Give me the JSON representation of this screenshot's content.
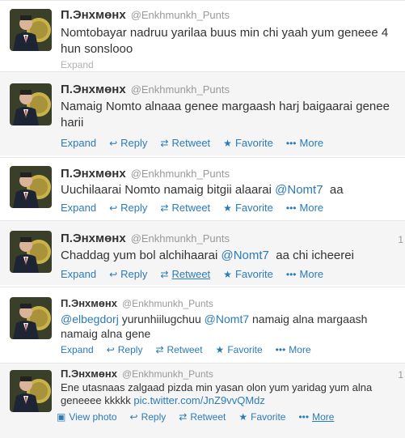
{
  "tweets": [
    {
      "name": "П.Энхмөнх",
      "handle": "@Enkhmunkh_Punts",
      "text": "Nomtobayar nadruu yarilaa buus min chi yaah yum geneee 4 hun sonslooo",
      "partial_action": "Expand"
    },
    {
      "name": "П.Энхмөнх",
      "handle": "@Enkhmunkh_Punts",
      "text": "Namaig Nomto alnaaa genee margaash harj baigaarai genee harii",
      "actions": {
        "expand": "Expand",
        "reply": "Reply",
        "retweet": "Retweet",
        "favorite": "Favorite",
        "more": "More"
      }
    },
    {
      "name": "П.Энхмөнх",
      "handle": "@Enkhmunkh_Punts",
      "text_before": "Uuchilaarai Nomto namaig bitgii alaarai ",
      "mention": "@Nomt7",
      "text_after": "  aa",
      "actions": {
        "expand": "Expand",
        "reply": "Reply",
        "retweet": "Retweet",
        "favorite": "Favorite",
        "more": "More"
      }
    },
    {
      "name": "П.Энхмөнх",
      "handle": "@Enkhmunkh_Punts",
      "timestamp": "1",
      "text_before": "Chaddag yum bol alchihaarai ",
      "mention": "@Nomt7",
      "text_after": "  aa chi icheerei",
      "actions": {
        "expand": "Expand",
        "reply": "Reply",
        "retweet": "Retweet",
        "favorite": "Favorite",
        "more": "More"
      }
    },
    {
      "name": "П.Энхмөнх",
      "handle": "@Enkhmunkh_Punts",
      "mention1": "@elbegdorj",
      "text_mid": " yurunhiilugchuu ",
      "mention2": "@Nomt7",
      "text_after": " namaig alna margaash namaig alna gene",
      "actions": {
        "expand": "Expand",
        "reply": "Reply",
        "retweet": "Retweet",
        "favorite": "Favorite",
        "more": "More"
      }
    },
    {
      "name": "П.Энхмөнх",
      "handle": "@Enkhmunkh_Punts",
      "timestamp": "1",
      "text": "Ene utasnaas zalgaad pizda min yasan olon yum yaridag yum alna geneeee kkkkk ",
      "link": "pic.twitter.com/JnZ9vvQMdz",
      "actions": {
        "view_photo": "View photo",
        "reply": "Reply",
        "retweet": "Retweet",
        "favorite": "Favorite",
        "more": "More"
      }
    }
  ],
  "colors": {
    "link": "#2b7bb9",
    "name": "#333333",
    "handle": "#999999",
    "row_alt": "#f5f5f5"
  }
}
